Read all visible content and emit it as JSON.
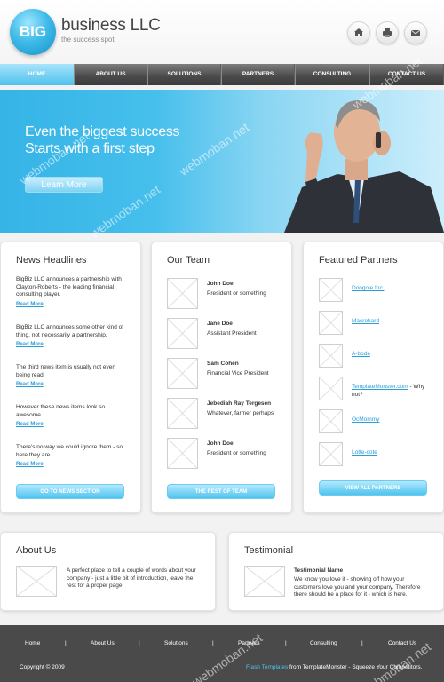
{
  "header": {
    "logo_badge": "BIG",
    "logo_title": "business LLC",
    "logo_tagline": "the success spot",
    "icons": [
      "home-icon",
      "print-icon",
      "mail-icon"
    ]
  },
  "nav": {
    "items": [
      {
        "label": "HOME"
      },
      {
        "label": "ABOUT US"
      },
      {
        "label": "SOLUTIONS"
      },
      {
        "label": "PARTNERS"
      },
      {
        "label": "CONSULTING"
      },
      {
        "label": "CONTACT US"
      }
    ]
  },
  "hero": {
    "headline_1": "Even the biggest success",
    "headline_2": "Starts with a first step",
    "button_label": "Learn More"
  },
  "news": {
    "title": "News Headlines",
    "items": [
      {
        "text": "BigBiz LLC announces a partnership with Clayton-Roberts - the leading financial consulting player.",
        "link": "Read More"
      },
      {
        "text": "BigBiz LLC announces some other kind of thing, not necessarily a partnership.",
        "link": "Read More"
      },
      {
        "text": "The third news item is usually not even being read.",
        "link": "Read More"
      },
      {
        "text": "However these news items look so awesome.",
        "link": "Read More"
      },
      {
        "text": "There's no way we could ignore them - so here they are",
        "link": "Read More"
      }
    ],
    "button_label": "GO TO NEWS SECTION"
  },
  "team": {
    "title": "Our Team",
    "members": [
      {
        "name": "John Doe",
        "role": "President or something"
      },
      {
        "name": "Jane Doe",
        "role": "Assistant President"
      },
      {
        "name": "Sam Cohen",
        "role": "Financial Vice President"
      },
      {
        "name": "Jebediah Ray Tergesen",
        "role": "Whatever, farmer perhaps"
      },
      {
        "name": "John Doe",
        "role": "President or something"
      }
    ],
    "button_label": "THE REST OF TEAM"
  },
  "partners": {
    "title": "Featured Partners",
    "items": [
      {
        "label": "Doogole Inc."
      },
      {
        "label": "Macrohard"
      },
      {
        "label": "A-bode"
      },
      {
        "label": "TemplateMonster.com",
        "extra": " - Why not?"
      },
      {
        "label": "OcMommy"
      },
      {
        "label": "Lotte-cote"
      }
    ],
    "button_label": "VIEW ALL PARTNERS"
  },
  "about": {
    "title": "About Us",
    "text": "A perfect place to tell a couple of words about your company - just a little bit of introduction, leave the rest for a proper page."
  },
  "testimonial": {
    "title": "Testimonial",
    "name": "Testimonial Name",
    "text": "We know you love it - showing off how your customers love you and your company. Therefore there should be a place for it - which is here."
  },
  "footer": {
    "links": [
      "Home",
      "About Us",
      "Solutions",
      "Partners",
      "Consulting",
      "Contact Us"
    ],
    "separator": "|",
    "copyright": "Copyright © 2009",
    "credits_link": "Flash Templates",
    "credits_text": " from TemplateMonster - Squeeze Your Competitors."
  },
  "watermark": "webmoban.net",
  "colors": {
    "accent": "#4fc3ee",
    "link": "#2a9ed8",
    "nav_dark": "#4a4a4a",
    "footer_bg": "#4a4a4a"
  }
}
